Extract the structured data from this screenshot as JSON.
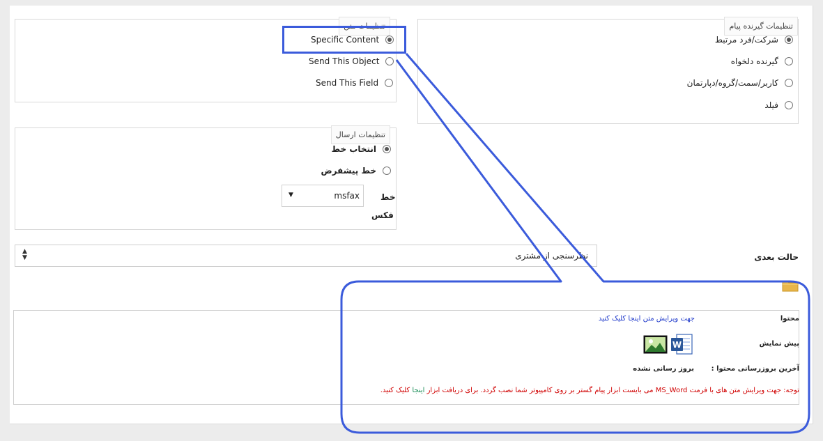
{
  "recipient_settings": {
    "legend": "تنظیمات گیرنده پیام",
    "options": [
      {
        "label": "شرکت/فرد مرتبط",
        "selected": true
      },
      {
        "label": "گیرنده دلخواه",
        "selected": false
      },
      {
        "label": "کاربر/سمت/گروه/دپارتمان",
        "selected": false
      },
      {
        "label": "فیلد",
        "selected": false
      }
    ]
  },
  "text_settings": {
    "legend": "تنظیمات متن",
    "options": [
      {
        "label": "Specific Content",
        "selected": true
      },
      {
        "label": "Send This Object",
        "selected": false
      },
      {
        "label": "Send This Field",
        "selected": false
      }
    ]
  },
  "send_settings": {
    "legend": "تنظیمات ارسال",
    "options": [
      {
        "label": "انتخاب خط",
        "selected": true
      },
      {
        "label": "خط پیشفرض",
        "selected": false
      }
    ],
    "line_label": "خط",
    "line_value": "msfax",
    "fax_label": "فکس"
  },
  "next_state": {
    "label": "حالت بعدی",
    "value": "نظرسنجی از مشتری"
  },
  "content": {
    "label": "محتوا",
    "edit_link": "جهت ویرایش متن اینجا کلیک کنید",
    "preview_label": "پیش نمایش",
    "last_update_label": "آخرین بروزرسانی محتوا :",
    "last_update_value": "بروز رسانی نشده",
    "note_prefix": "توجه: جهت ویرایش متن های با فرمت MS_Word می بایست ابزار پیام گستر بر روی کامپیوتر شما نصب گردد. برای دریافت ابزار ",
    "note_link": "اینجا",
    "note_suffix": " کلیک کنید."
  },
  "colors": {
    "annotation": "#3b5bdb",
    "link": "#1a35c9",
    "warning": "#d00000",
    "folder": "#e9b64a"
  }
}
